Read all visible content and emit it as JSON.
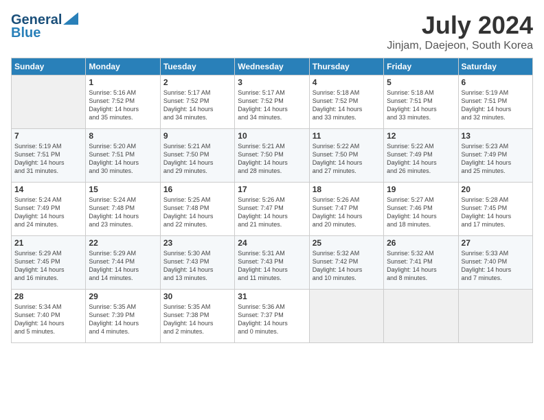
{
  "logo": {
    "line1": "General",
    "line2": "Blue",
    "tagline": ""
  },
  "title": "July 2024",
  "location": "Jinjam, Daejeon, South Korea",
  "headers": [
    "Sunday",
    "Monday",
    "Tuesday",
    "Wednesday",
    "Thursday",
    "Friday",
    "Saturday"
  ],
  "weeks": [
    [
      {
        "day": "",
        "info": ""
      },
      {
        "day": "1",
        "info": "Sunrise: 5:16 AM\nSunset: 7:52 PM\nDaylight: 14 hours\nand 35 minutes."
      },
      {
        "day": "2",
        "info": "Sunrise: 5:17 AM\nSunset: 7:52 PM\nDaylight: 14 hours\nand 34 minutes."
      },
      {
        "day": "3",
        "info": "Sunrise: 5:17 AM\nSunset: 7:52 PM\nDaylight: 14 hours\nand 34 minutes."
      },
      {
        "day": "4",
        "info": "Sunrise: 5:18 AM\nSunset: 7:52 PM\nDaylight: 14 hours\nand 33 minutes."
      },
      {
        "day": "5",
        "info": "Sunrise: 5:18 AM\nSunset: 7:51 PM\nDaylight: 14 hours\nand 33 minutes."
      },
      {
        "day": "6",
        "info": "Sunrise: 5:19 AM\nSunset: 7:51 PM\nDaylight: 14 hours\nand 32 minutes."
      }
    ],
    [
      {
        "day": "7",
        "info": "Sunrise: 5:19 AM\nSunset: 7:51 PM\nDaylight: 14 hours\nand 31 minutes."
      },
      {
        "day": "8",
        "info": "Sunrise: 5:20 AM\nSunset: 7:51 PM\nDaylight: 14 hours\nand 30 minutes."
      },
      {
        "day": "9",
        "info": "Sunrise: 5:21 AM\nSunset: 7:50 PM\nDaylight: 14 hours\nand 29 minutes."
      },
      {
        "day": "10",
        "info": "Sunrise: 5:21 AM\nSunset: 7:50 PM\nDaylight: 14 hours\nand 28 minutes."
      },
      {
        "day": "11",
        "info": "Sunrise: 5:22 AM\nSunset: 7:50 PM\nDaylight: 14 hours\nand 27 minutes."
      },
      {
        "day": "12",
        "info": "Sunrise: 5:22 AM\nSunset: 7:49 PM\nDaylight: 14 hours\nand 26 minutes."
      },
      {
        "day": "13",
        "info": "Sunrise: 5:23 AM\nSunset: 7:49 PM\nDaylight: 14 hours\nand 25 minutes."
      }
    ],
    [
      {
        "day": "14",
        "info": "Sunrise: 5:24 AM\nSunset: 7:49 PM\nDaylight: 14 hours\nand 24 minutes."
      },
      {
        "day": "15",
        "info": "Sunrise: 5:24 AM\nSunset: 7:48 PM\nDaylight: 14 hours\nand 23 minutes."
      },
      {
        "day": "16",
        "info": "Sunrise: 5:25 AM\nSunset: 7:48 PM\nDaylight: 14 hours\nand 22 minutes."
      },
      {
        "day": "17",
        "info": "Sunrise: 5:26 AM\nSunset: 7:47 PM\nDaylight: 14 hours\nand 21 minutes."
      },
      {
        "day": "18",
        "info": "Sunrise: 5:26 AM\nSunset: 7:47 PM\nDaylight: 14 hours\nand 20 minutes."
      },
      {
        "day": "19",
        "info": "Sunrise: 5:27 AM\nSunset: 7:46 PM\nDaylight: 14 hours\nand 18 minutes."
      },
      {
        "day": "20",
        "info": "Sunrise: 5:28 AM\nSunset: 7:45 PM\nDaylight: 14 hours\nand 17 minutes."
      }
    ],
    [
      {
        "day": "21",
        "info": "Sunrise: 5:29 AM\nSunset: 7:45 PM\nDaylight: 14 hours\nand 16 minutes."
      },
      {
        "day": "22",
        "info": "Sunrise: 5:29 AM\nSunset: 7:44 PM\nDaylight: 14 hours\nand 14 minutes."
      },
      {
        "day": "23",
        "info": "Sunrise: 5:30 AM\nSunset: 7:43 PM\nDaylight: 14 hours\nand 13 minutes."
      },
      {
        "day": "24",
        "info": "Sunrise: 5:31 AM\nSunset: 7:43 PM\nDaylight: 14 hours\nand 11 minutes."
      },
      {
        "day": "25",
        "info": "Sunrise: 5:32 AM\nSunset: 7:42 PM\nDaylight: 14 hours\nand 10 minutes."
      },
      {
        "day": "26",
        "info": "Sunrise: 5:32 AM\nSunset: 7:41 PM\nDaylight: 14 hours\nand 8 minutes."
      },
      {
        "day": "27",
        "info": "Sunrise: 5:33 AM\nSunset: 7:40 PM\nDaylight: 14 hours\nand 7 minutes."
      }
    ],
    [
      {
        "day": "28",
        "info": "Sunrise: 5:34 AM\nSunset: 7:40 PM\nDaylight: 14 hours\nand 5 minutes."
      },
      {
        "day": "29",
        "info": "Sunrise: 5:35 AM\nSunset: 7:39 PM\nDaylight: 14 hours\nand 4 minutes."
      },
      {
        "day": "30",
        "info": "Sunrise: 5:35 AM\nSunset: 7:38 PM\nDaylight: 14 hours\nand 2 minutes."
      },
      {
        "day": "31",
        "info": "Sunrise: 5:36 AM\nSunset: 7:37 PM\nDaylight: 14 hours\nand 0 minutes."
      },
      {
        "day": "",
        "info": ""
      },
      {
        "day": "",
        "info": ""
      },
      {
        "day": "",
        "info": ""
      }
    ]
  ]
}
